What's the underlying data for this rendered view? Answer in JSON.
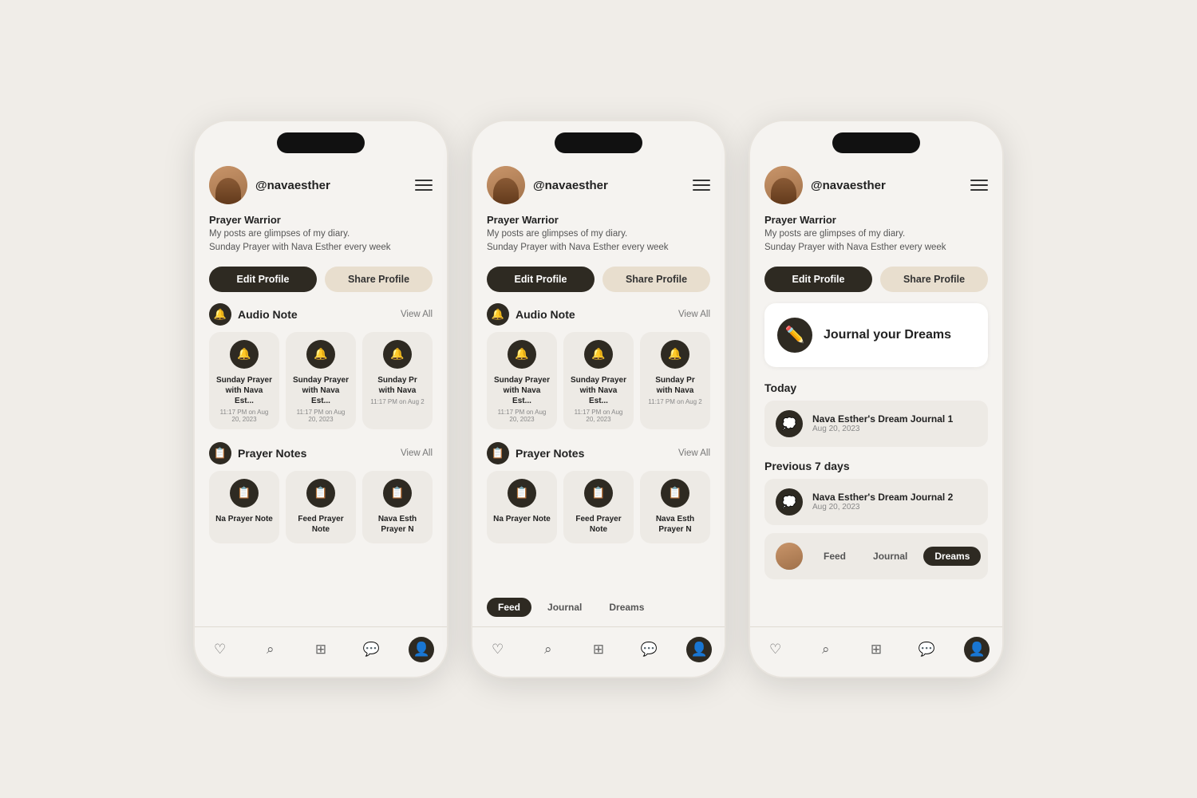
{
  "phones": [
    {
      "id": "phone1",
      "username": "@navaesther",
      "bio_title": "Prayer Warrior",
      "bio_lines": [
        "My posts are glimpses of my diary.",
        "Sunday Prayer with Nava Esther every week"
      ],
      "edit_label": "Edit Profile",
      "share_label": "Share Profile",
      "sections": [
        {
          "id": "audio",
          "icon": "🔔",
          "label": "Audio Note",
          "view_all": "View All",
          "cards": [
            {
              "title": "Sunday Prayer with Nava Est...",
              "date": "11:17 PM on Aug 20, 2023"
            },
            {
              "title": "Sunday Prayer with Nava Est...",
              "date": "11:17 PM on Aug 20, 2023"
            },
            {
              "title": "Sunday Pr with Nava",
              "date": "11:17 PM on Aug 2"
            }
          ]
        },
        {
          "id": "prayer",
          "icon": "📋",
          "label": "Prayer Notes",
          "view_all": "View All",
          "cards": [
            {
              "title": "Na Prayer Note",
              "date": ""
            },
            {
              "title": "Feed Prayer Note",
              "date": ""
            },
            {
              "title": "Nava Esth Prayer N",
              "date": ""
            }
          ]
        }
      ],
      "active_nav": "profile"
    },
    {
      "id": "phone2",
      "username": "@navaesther",
      "bio_title": "Prayer Warrior",
      "bio_lines": [
        "My posts are glimpses of my diary.",
        "Sunday Prayer with Nava Esther every week"
      ],
      "edit_label": "Edit Profile",
      "share_label": "Share Profile",
      "sections": [
        {
          "id": "audio",
          "icon": "🔔",
          "label": "Audio Note",
          "view_all": "View All",
          "cards": [
            {
              "title": "Sunday Prayer with Nava Est...",
              "date": "11:17 PM on Aug 20, 2023"
            },
            {
              "title": "Sunday Prayer with Nava Est...",
              "date": "11:17 PM on Aug 20, 2023"
            },
            {
              "title": "Sunday Pr with Nava",
              "date": "11:17 PM on Aug 2"
            }
          ]
        },
        {
          "id": "prayer",
          "icon": "📋",
          "label": "Prayer Notes",
          "view_all": "View All",
          "cards": [
            {
              "title": "Na Prayer Note",
              "date": ""
            },
            {
              "title": "Feed Prayer Note",
              "date": ""
            },
            {
              "title": "Nava Esth Prayer N",
              "date": ""
            }
          ]
        }
      ],
      "active_nav": "profile",
      "active_tab": "Feed"
    },
    {
      "id": "phone3",
      "username": "@navaesther",
      "bio_title": "Prayer Warrior",
      "bio_lines": [
        "My posts are glimpses of my diary.",
        "Sunday Prayer with Nava Esther every week"
      ],
      "edit_label": "Edit Profile",
      "share_label": "Share Profile",
      "journal_card_label": "Journal your Dreams",
      "today_label": "Today",
      "today_entries": [
        {
          "title": "Nava Esther's Dream Journal 1",
          "date": "Aug 20, 2023"
        }
      ],
      "prev_label": "Previous 7 days",
      "prev_entries": [
        {
          "title": "Nava Esther's Dream Journal 2",
          "date": "Aug 20, 2023"
        },
        {
          "title": "",
          "date": ""
        }
      ],
      "tabs": [
        "Feed",
        "Journal",
        "Dreams"
      ],
      "active_tab": "Dreams",
      "active_nav": "profile"
    }
  ],
  "nav_icons": [
    "♡",
    "🔍",
    "⊞",
    "💬",
    "👤"
  ]
}
